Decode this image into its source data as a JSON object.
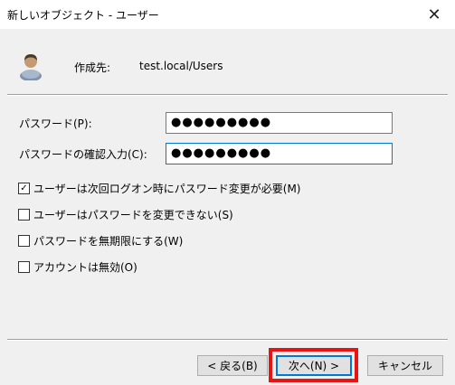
{
  "window": {
    "title": "新しいオブジェクト - ユーザー",
    "close_glyph": "✕"
  },
  "header": {
    "create_in_label": "作成先:",
    "create_in_value": "test.local/Users",
    "icon": "user-icon"
  },
  "form": {
    "password_label": "パスワード(P):",
    "password_value": "●●●●●●●●●",
    "confirm_label": "パスワードの確認入力(C):",
    "confirm_value": "●●●●●●●●●"
  },
  "options": [
    {
      "label": "ユーザーは次回ログオン時にパスワード変更が必要(M)",
      "checked": true,
      "mark": "✓"
    },
    {
      "label": "ユーザーはパスワードを変更できない(S)",
      "checked": false,
      "mark": ""
    },
    {
      "label": "パスワードを無期限にする(W)",
      "checked": false,
      "mark": ""
    },
    {
      "label": "アカウントは無効(O)",
      "checked": false,
      "mark": ""
    }
  ],
  "buttons": {
    "back": "< 戻る(B)",
    "next": "次へ(N) >",
    "cancel": "キャンセル"
  },
  "colors": {
    "highlight": "#e81313",
    "focus": "#0078d7"
  }
}
